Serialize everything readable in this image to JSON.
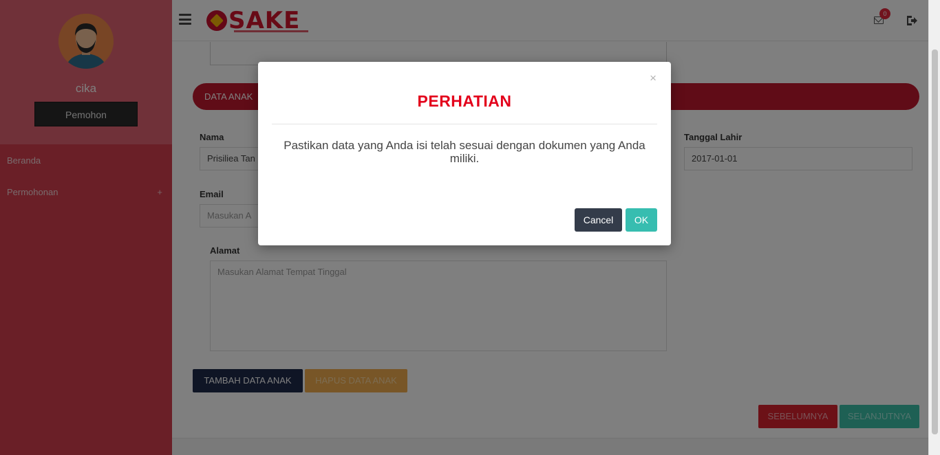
{
  "sidebar": {
    "username": "cika",
    "role": "Pemohon",
    "items": [
      {
        "label": "Beranda"
      },
      {
        "label": "Permohonan",
        "expand_icon": "+"
      }
    ]
  },
  "header": {
    "logo_text": "SAKE",
    "notification_count": "0"
  },
  "main": {
    "section_title": "DATA ANAK",
    "fields": {
      "nama_label": "Nama",
      "nama_value": "Prisiliea Tan",
      "tanggal_lahir_label": "Tanggal Lahir",
      "tanggal_lahir_value": "2017-01-01",
      "email_label": "Email",
      "email_placeholder": "Masukan A",
      "alamat_label": "Alamat",
      "alamat_placeholder": "Masukan Alamat Tempat Tinggal"
    },
    "buttons": {
      "add_child": "TAMBAH DATA ANAK",
      "delete_child": "HAPUS DATA ANAK",
      "previous": "SEBELUMNYA",
      "next": "SELANJUTNYA"
    }
  },
  "modal": {
    "close_symbol": "×",
    "title": "PERHATIAN",
    "message": "Pastikan data yang Anda isi telah sesuai dengan dokumen yang Anda miliki.",
    "cancel_label": "Cancel",
    "ok_label": "OK"
  },
  "colors": {
    "sidebar": "#d43f4f",
    "section_bar": "#c0182e",
    "modal_title": "#e3001b",
    "ok_button": "#37bdb0",
    "cancel_button": "#343c4a"
  }
}
